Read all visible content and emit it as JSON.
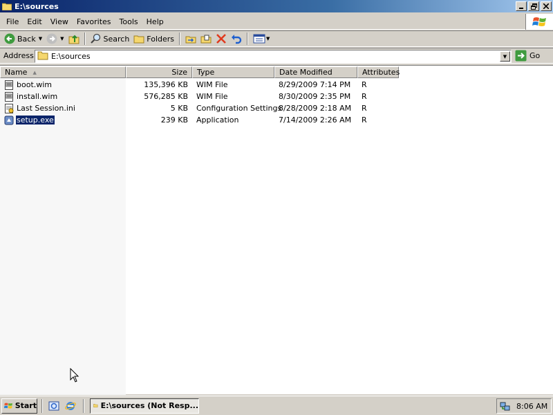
{
  "window": {
    "title": "E:\\sources"
  },
  "menu": [
    "File",
    "Edit",
    "View",
    "Favorites",
    "Tools",
    "Help"
  ],
  "toolbar": {
    "back_label": "Back",
    "search_label": "Search",
    "folders_label": "Folders"
  },
  "address": {
    "label": "Address",
    "value": "E:\\sources",
    "go_label": "Go"
  },
  "columns": {
    "name": "Name",
    "size": "Size",
    "type": "Type",
    "date": "Date Modified",
    "attributes": "Attributes"
  },
  "files": [
    {
      "name": "boot.wim",
      "size": "135,396 KB",
      "type": "WIM File",
      "date": "8/29/2009 7:14 PM",
      "attr": "R",
      "icon": "wim-file-icon"
    },
    {
      "name": "install.wim",
      "size": "576,285 KB",
      "type": "WIM File",
      "date": "8/30/2009 2:35 PM",
      "attr": "R",
      "icon": "wim-file-icon"
    },
    {
      "name": "Last Session.ini",
      "size": "5 KB",
      "type": "Configuration Settings",
      "date": "8/28/2009 2:18 AM",
      "attr": "R",
      "icon": "ini-file-icon"
    },
    {
      "name": "setup.exe",
      "size": "239 KB",
      "type": "Application",
      "date": "7/14/2009 2:26 AM",
      "attr": "R",
      "icon": "setup-exe-icon",
      "selected": true
    }
  ],
  "taskbar": {
    "start_label": "Start",
    "task_label": "E:\\sources (Not Resp...",
    "clock": "8:06 AM"
  },
  "colors": {
    "title_bar": "#0a246a",
    "selection": "#0a246a",
    "face": "#d4d0c8"
  }
}
